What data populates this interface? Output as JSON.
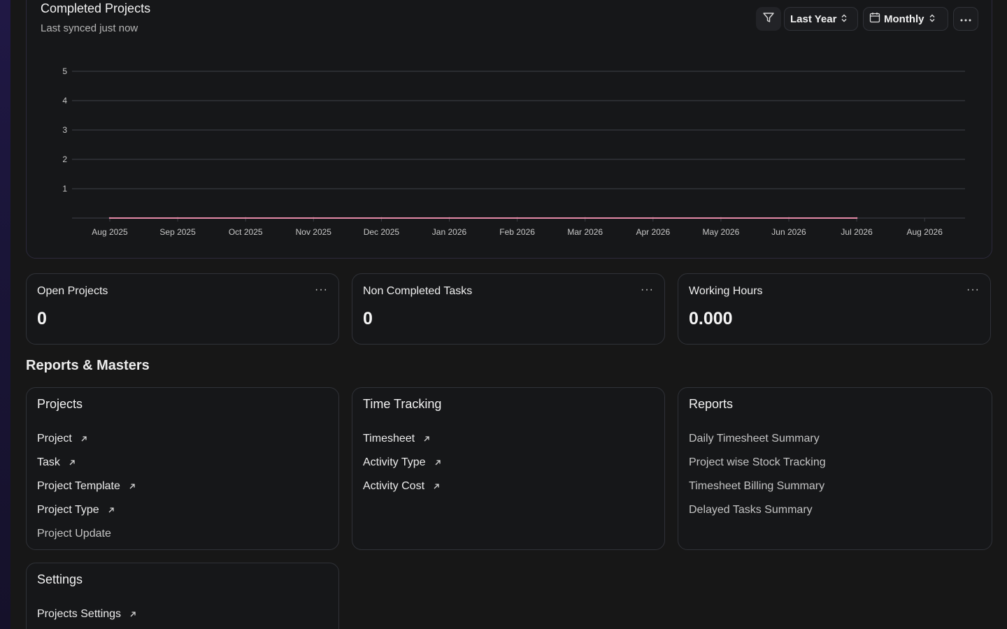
{
  "chart_card": {
    "title": "Completed Projects",
    "subtitle": "Last synced just now",
    "controls": {
      "filter_icon": "filter-icon",
      "range_label": "Last Year",
      "period_label": "Monthly",
      "more_icon": "ellipsis-icon"
    }
  },
  "chart_data": {
    "type": "line",
    "title": "Completed Projects",
    "categories": [
      "Aug 2025",
      "Sep 2025",
      "Oct 2025",
      "Nov 2025",
      "Dec 2025",
      "Jan 2026",
      "Feb 2026",
      "Mar 2026",
      "Apr 2026",
      "May 2026",
      "Jun 2026",
      "Jul 2026",
      "Aug 2026"
    ],
    "series": [
      {
        "values": [
          0,
          0,
          0,
          0,
          0,
          0,
          0,
          0,
          0,
          0,
          0,
          0
        ],
        "color": "#e58aa8"
      }
    ],
    "y_ticks": [
      1,
      2,
      3,
      4,
      5
    ],
    "ylim": [
      0,
      5
    ],
    "grid": true,
    "xlabel": "",
    "ylabel": ""
  },
  "stats": [
    {
      "title": "Open Projects",
      "value": "0",
      "more": "···"
    },
    {
      "title": "Non Completed Tasks",
      "value": "0",
      "more": "···"
    },
    {
      "title": "Working Hours",
      "value": "0.000",
      "more": "···"
    }
  ],
  "section_title": "Reports & Masters",
  "cards": {
    "projects": {
      "title": "Projects",
      "items": [
        {
          "label": "Project",
          "link": true
        },
        {
          "label": "Task",
          "link": true
        },
        {
          "label": "Project Template",
          "link": true
        },
        {
          "label": "Project Type",
          "link": true
        },
        {
          "label": "Project Update",
          "link": false
        }
      ]
    },
    "time_tracking": {
      "title": "Time Tracking",
      "items": [
        {
          "label": "Timesheet",
          "link": true
        },
        {
          "label": "Activity Type",
          "link": true
        },
        {
          "label": "Activity Cost",
          "link": true
        }
      ]
    },
    "reports": {
      "title": "Reports",
      "items": [
        {
          "label": "Daily Timesheet Summary",
          "link": false
        },
        {
          "label": "Project wise Stock Tracking",
          "link": false
        },
        {
          "label": "Timesheet Billing Summary",
          "link": false
        },
        {
          "label": "Delayed Tasks Summary",
          "link": false
        }
      ]
    },
    "settings": {
      "title": "Settings",
      "items": [
        {
          "label": "Projects Settings",
          "link": true
        }
      ]
    }
  },
  "colors": {
    "background": "#171717",
    "card": "#161719",
    "border": "#303238",
    "line": "#e58aa8",
    "accent_strip": "#201845"
  }
}
